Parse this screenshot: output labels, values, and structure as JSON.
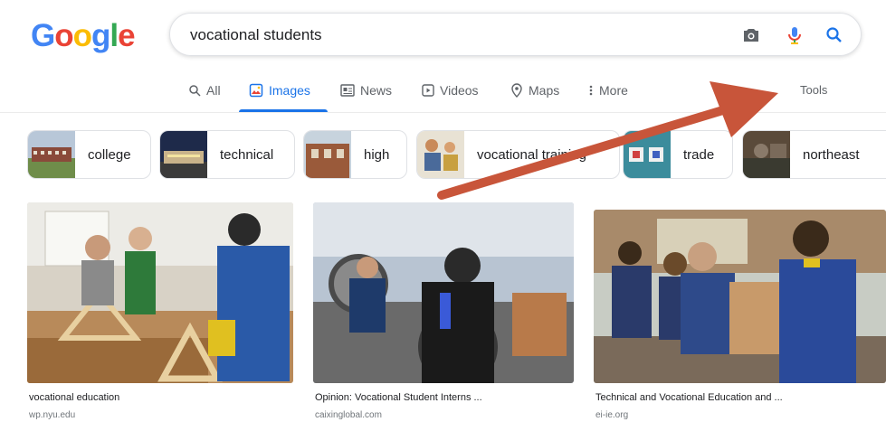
{
  "logo": {
    "letters": [
      "G",
      "o",
      "o",
      "g",
      "l",
      "e"
    ]
  },
  "search": {
    "query": "vocational students"
  },
  "search_icons": [
    "camera-icon",
    "microphone-icon",
    "search-icon"
  ],
  "tabs": [
    {
      "label": "All",
      "icon": "search-icon"
    },
    {
      "label": "Images",
      "icon": "image-icon",
      "active": true
    },
    {
      "label": "News",
      "icon": "news-icon"
    },
    {
      "label": "Videos",
      "icon": "video-icon"
    },
    {
      "label": "Maps",
      "icon": "map-pin-icon"
    },
    {
      "label": "More",
      "icon": "more-dots-icon"
    }
  ],
  "tools_label": "Tools",
  "chips": [
    {
      "label": "college"
    },
    {
      "label": "technical"
    },
    {
      "label": "high"
    },
    {
      "label": "vocational training"
    },
    {
      "label": "trade"
    },
    {
      "label": "northeast"
    }
  ],
  "results": [
    {
      "title": "vocational education",
      "source": "wp.nyu.edu"
    },
    {
      "title": "Opinion: Vocational Student Interns ...",
      "source": "caixinglobal.com"
    },
    {
      "title": "Technical and Vocational Education and ...",
      "source": "ei-ie.org"
    }
  ],
  "colors": {
    "accent": "#1a73e8",
    "annotation_arrow": "#c8553a"
  }
}
